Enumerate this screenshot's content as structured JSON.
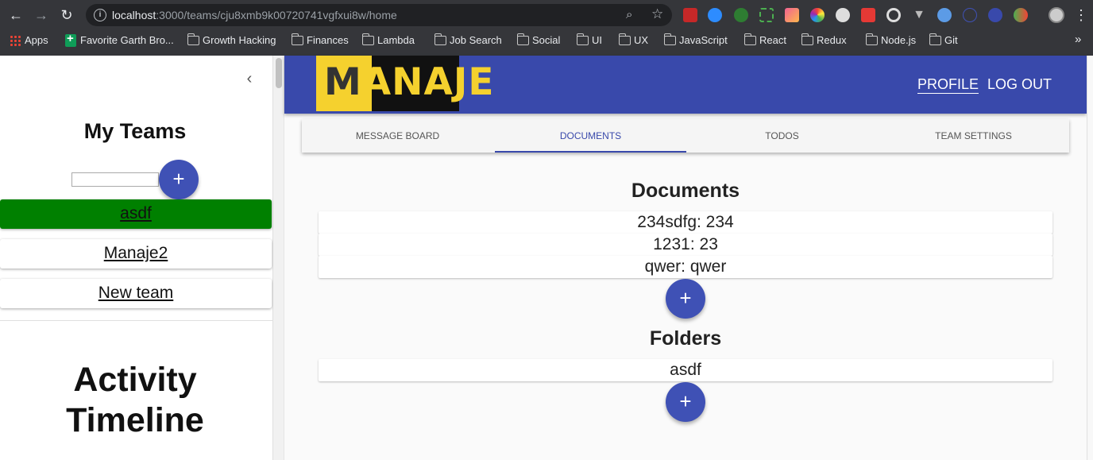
{
  "browser": {
    "url_host": "localhost",
    "url_rest": ":3000/teams/cju8xmb9k00720741vgfxui8w/home",
    "bookmarks": [
      "Apps",
      "Favorite Garth Bro...",
      "Growth Hacking",
      "Finances",
      "Lambda",
      "Job Search",
      "Social",
      "UI",
      "UX",
      "JavaScript",
      "React",
      "Redux",
      "Node.js",
      "Git"
    ],
    "more": "»"
  },
  "sidebar": {
    "title": "My Teams",
    "add_label": "+",
    "teams": [
      "asdf",
      "Manaje2",
      "New team"
    ],
    "activity_title_1": "Activity",
    "activity_title_2": "Timeline"
  },
  "header": {
    "logo_text_m": "M",
    "logo_text_rest": "ANAJE",
    "profile": "PROFILE",
    "logout": "LOG OUT"
  },
  "tabs": [
    "MESSAGE BOARD",
    "DOCUMENTS",
    "TODOS",
    "TEAM SETTINGS"
  ],
  "documents": {
    "title": "Documents",
    "items": [
      "234sdfg: 234",
      "1231: 23",
      "qwer: qwer"
    ],
    "add_label": "+"
  },
  "folders": {
    "title": "Folders",
    "items": [
      "asdf"
    ],
    "add_label": "+"
  },
  "colors": {
    "appbar": "#3949ab",
    "active_team": "#008000",
    "fab": "#3f51b5",
    "logo_yellow": "#f5d12e"
  }
}
